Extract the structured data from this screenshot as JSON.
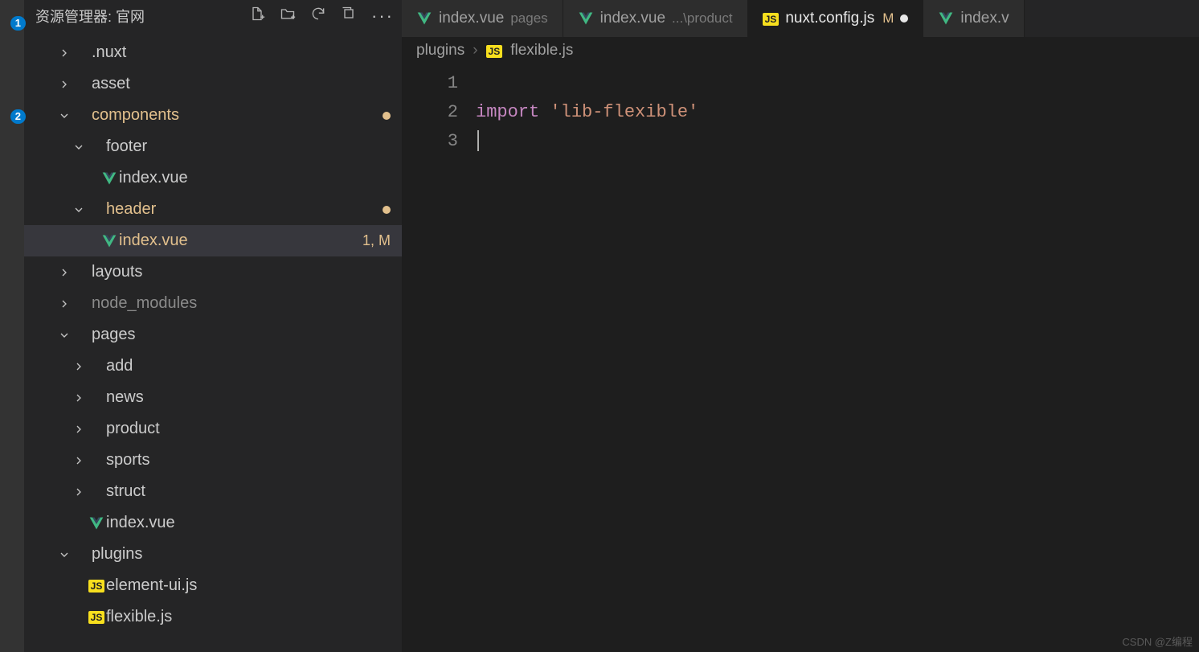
{
  "activityBar": {
    "badges": {
      "explorer": "1",
      "scm": "2"
    }
  },
  "sidebar": {
    "title": "资源管理器: 官网",
    "actionIcons": [
      "new-file",
      "new-folder",
      "refresh",
      "collapse",
      "more"
    ]
  },
  "tree": [
    {
      "depth": 0,
      "kind": "folder",
      "expanded": false,
      "label": ".nuxt"
    },
    {
      "depth": 0,
      "kind": "folder",
      "expanded": false,
      "label": "asset"
    },
    {
      "depth": 0,
      "kind": "folder",
      "expanded": true,
      "label": "components",
      "mod": true,
      "dot": true
    },
    {
      "depth": 1,
      "kind": "folder",
      "expanded": true,
      "label": "footer"
    },
    {
      "depth": 2,
      "kind": "file",
      "icon": "vue",
      "label": "index.vue"
    },
    {
      "depth": 1,
      "kind": "folder",
      "expanded": true,
      "label": "header",
      "mod": true,
      "dot": true
    },
    {
      "depth": 2,
      "kind": "file",
      "icon": "vue",
      "label": "index.vue",
      "mod": true,
      "decor": "1, M",
      "selected": true
    },
    {
      "depth": 0,
      "kind": "folder",
      "expanded": false,
      "label": "layouts"
    },
    {
      "depth": 0,
      "kind": "folder",
      "expanded": false,
      "label": "node_modules",
      "dim": true
    },
    {
      "depth": 0,
      "kind": "folder",
      "expanded": true,
      "label": "pages"
    },
    {
      "depth": 1,
      "kind": "folder",
      "expanded": false,
      "label": "add"
    },
    {
      "depth": 1,
      "kind": "folder",
      "expanded": false,
      "label": "news"
    },
    {
      "depth": 1,
      "kind": "folder",
      "expanded": false,
      "label": "product"
    },
    {
      "depth": 1,
      "kind": "folder",
      "expanded": false,
      "label": "sports"
    },
    {
      "depth": 1,
      "kind": "folder",
      "expanded": false,
      "label": "struct"
    },
    {
      "depth": 1,
      "kind": "file",
      "icon": "vue",
      "label": "index.vue"
    },
    {
      "depth": 0,
      "kind": "folder",
      "expanded": true,
      "label": "plugins"
    },
    {
      "depth": 1,
      "kind": "file",
      "icon": "js",
      "label": "element-ui.js"
    },
    {
      "depth": 1,
      "kind": "file",
      "icon": "js",
      "label": "flexible.js"
    }
  ],
  "tabs": [
    {
      "icon": "vue",
      "name": "index.vue",
      "desc": "pages"
    },
    {
      "icon": "vue",
      "name": "index.vue",
      "desc": "...\\product"
    },
    {
      "icon": "js",
      "name": "nuxt.config.js",
      "mod": "M",
      "dirty": true,
      "active": true
    },
    {
      "icon": "vue",
      "name": "index.v",
      "truncated": true
    }
  ],
  "breadcrumbs": {
    "segments": [
      {
        "label": "plugins"
      },
      {
        "icon": "js",
        "label": "flexible.js"
      }
    ]
  },
  "code": {
    "lines": [
      {
        "num": "1",
        "tokens": []
      },
      {
        "num": "2",
        "tokens": [
          {
            "cls": "tok-kw",
            "text": "import"
          },
          {
            "cls": "",
            "text": " "
          },
          {
            "cls": "tok-str",
            "text": "'lib-flexible'"
          }
        ]
      },
      {
        "num": "3",
        "tokens": [],
        "cursor": true
      }
    ]
  },
  "watermark": "CSDN @Z编程"
}
